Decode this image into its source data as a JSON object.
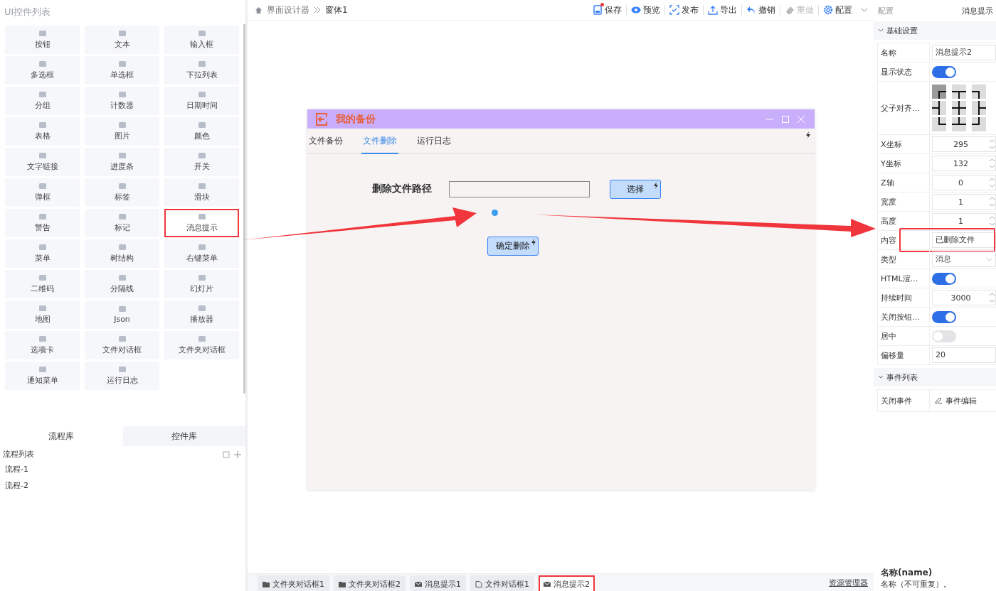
{
  "left_panel": {
    "title": "UI控件列表",
    "widgets": [
      {
        "label": "按钮",
        "highlighted": false
      },
      {
        "label": "文本",
        "highlighted": false
      },
      {
        "label": "输入框",
        "highlighted": false
      },
      {
        "label": "多选框",
        "highlighted": false
      },
      {
        "label": "单选框",
        "highlighted": false
      },
      {
        "label": "下拉列表",
        "highlighted": false
      },
      {
        "label": "分组",
        "highlighted": false
      },
      {
        "label": "计数器",
        "highlighted": false
      },
      {
        "label": "日期时间",
        "highlighted": false
      },
      {
        "label": "表格",
        "highlighted": false
      },
      {
        "label": "图片",
        "highlighted": false
      },
      {
        "label": "颜色",
        "highlighted": false
      },
      {
        "label": "文字链接",
        "highlighted": false
      },
      {
        "label": "进度条",
        "highlighted": false
      },
      {
        "label": "开关",
        "highlighted": false
      },
      {
        "label": "弹框",
        "highlighted": false
      },
      {
        "label": "标签",
        "highlighted": false
      },
      {
        "label": "滑块",
        "highlighted": false
      },
      {
        "label": "警告",
        "highlighted": false
      },
      {
        "label": "标记",
        "highlighted": false
      },
      {
        "label": "消息提示",
        "highlighted": true
      },
      {
        "label": "菜单",
        "highlighted": false
      },
      {
        "label": "树结构",
        "highlighted": false
      },
      {
        "label": "右键菜单",
        "highlighted": false
      },
      {
        "label": "二维码",
        "highlighted": false
      },
      {
        "label": "分隔线",
        "highlighted": false
      },
      {
        "label": "幻灯片",
        "highlighted": false
      },
      {
        "label": "地图",
        "highlighted": false
      },
      {
        "label": "Json",
        "highlighted": false
      },
      {
        "label": "播放器",
        "highlighted": false
      },
      {
        "label": "选项卡",
        "highlighted": false
      },
      {
        "label": "文件对话框",
        "highlighted": false
      },
      {
        "label": "文件夹对话框",
        "highlighted": false
      },
      {
        "label": "通知菜单",
        "highlighted": false
      },
      {
        "label": "运行日志",
        "highlighted": false
      }
    ],
    "tabs": [
      {
        "label": "流程库",
        "selected": true
      },
      {
        "label": "控件库",
        "selected": false
      }
    ],
    "flow_list": {
      "title": "流程列表",
      "items": [
        "流程-1",
        "流程-2"
      ]
    }
  },
  "breadcrumb": [
    "界面设计器",
    "窗体1"
  ],
  "toolbar": [
    {
      "label": "保存",
      "kind": "save",
      "badge": true,
      "disabled": false
    },
    {
      "label": "预览",
      "kind": "eye",
      "badge": false,
      "disabled": false
    },
    {
      "label": "发布",
      "kind": "publish",
      "badge": false,
      "disabled": false
    },
    {
      "label": "导出",
      "kind": "export",
      "badge": false,
      "disabled": false
    },
    {
      "label": "撤销",
      "kind": "undo",
      "badge": false,
      "disabled": false
    },
    {
      "label": "重做",
      "kind": "eraser",
      "badge": false,
      "disabled": true
    },
    {
      "label": "配置",
      "kind": "gear",
      "badge": false,
      "disabled": false
    }
  ],
  "form": {
    "title": "我的备份",
    "tabs": [
      {
        "label": "文件备份",
        "selected": false
      },
      {
        "label": "文件删除",
        "selected": true
      },
      {
        "label": "运行日志",
        "selected": false
      }
    ],
    "path_label": "删除文件路径",
    "choose_button": "选择",
    "confirm_button": "确定删除"
  },
  "properties": {
    "title": "配置",
    "selected_name": "消息提示",
    "sections": [
      {
        "title": "基础设置",
        "expanded": true,
        "rows": [
          {
            "label": "名称",
            "kind": "text",
            "value": "消息提示2",
            "highlighted": false
          },
          {
            "label": "显示状态",
            "kind": "toggle",
            "on": true,
            "highlighted": false
          },
          {
            "label": "父子对齐…",
            "kind": "align",
            "cells": [
              {
                "selected": true
              },
              {
                "selected": false
              },
              {
                "selected": false
              },
              {
                "selected": false
              },
              {
                "selected": false
              },
              {
                "selected": false
              },
              {
                "selected": false
              },
              {
                "selected": false
              },
              {
                "selected": false
              }
            ],
            "highlighted": false
          },
          {
            "label": "X坐标",
            "kind": "number",
            "value": "295",
            "highlighted": false
          },
          {
            "label": "Y坐标",
            "kind": "number",
            "value": "132",
            "highlighted": false
          },
          {
            "label": "Z轴",
            "kind": "number",
            "value": "0",
            "highlighted": false
          },
          {
            "label": "宽度",
            "kind": "number",
            "value": "1",
            "highlighted": false
          },
          {
            "label": "高度",
            "kind": "number",
            "value": "1",
            "highlighted": false
          },
          {
            "label": "内容",
            "kind": "text",
            "value": "已删除文件",
            "highlighted": true
          },
          {
            "label": "类型",
            "kind": "select",
            "value": "消息",
            "highlighted": false
          },
          {
            "label": "HTML渲…",
            "kind": "toggle",
            "on": true,
            "highlighted": false
          },
          {
            "label": "持续时间",
            "kind": "number",
            "value": "3000",
            "highlighted": false
          },
          {
            "label": "关闭按钮…",
            "kind": "toggle",
            "on": true,
            "highlighted": false
          },
          {
            "label": "居中",
            "kind": "toggle",
            "on": false,
            "highlighted": false
          },
          {
            "label": "偏移量",
            "kind": "text",
            "value": "20",
            "highlighted": false
          }
        ]
      },
      {
        "title": "事件列表",
        "expanded": true,
        "rows": [
          {
            "label": "关闭事件",
            "kind": "event",
            "value": "事件编辑",
            "highlighted": false
          }
        ]
      }
    ]
  },
  "bottom_tabs": [
    {
      "label": "文件夹对话框1",
      "kind": "folder",
      "highlighted": false
    },
    {
      "label": "文件夹对话框2",
      "kind": "folder",
      "highlighted": false
    },
    {
      "label": "消息提示1",
      "kind": "mail",
      "highlighted": false
    },
    {
      "label": "文件对话框1",
      "kind": "file",
      "highlighted": false
    },
    {
      "label": "消息提示2",
      "kind": "mail",
      "highlighted": true
    }
  ],
  "resource_link": "资源管理器",
  "help": {
    "title": "名称(name)",
    "text": "名称（不可重复）。"
  }
}
